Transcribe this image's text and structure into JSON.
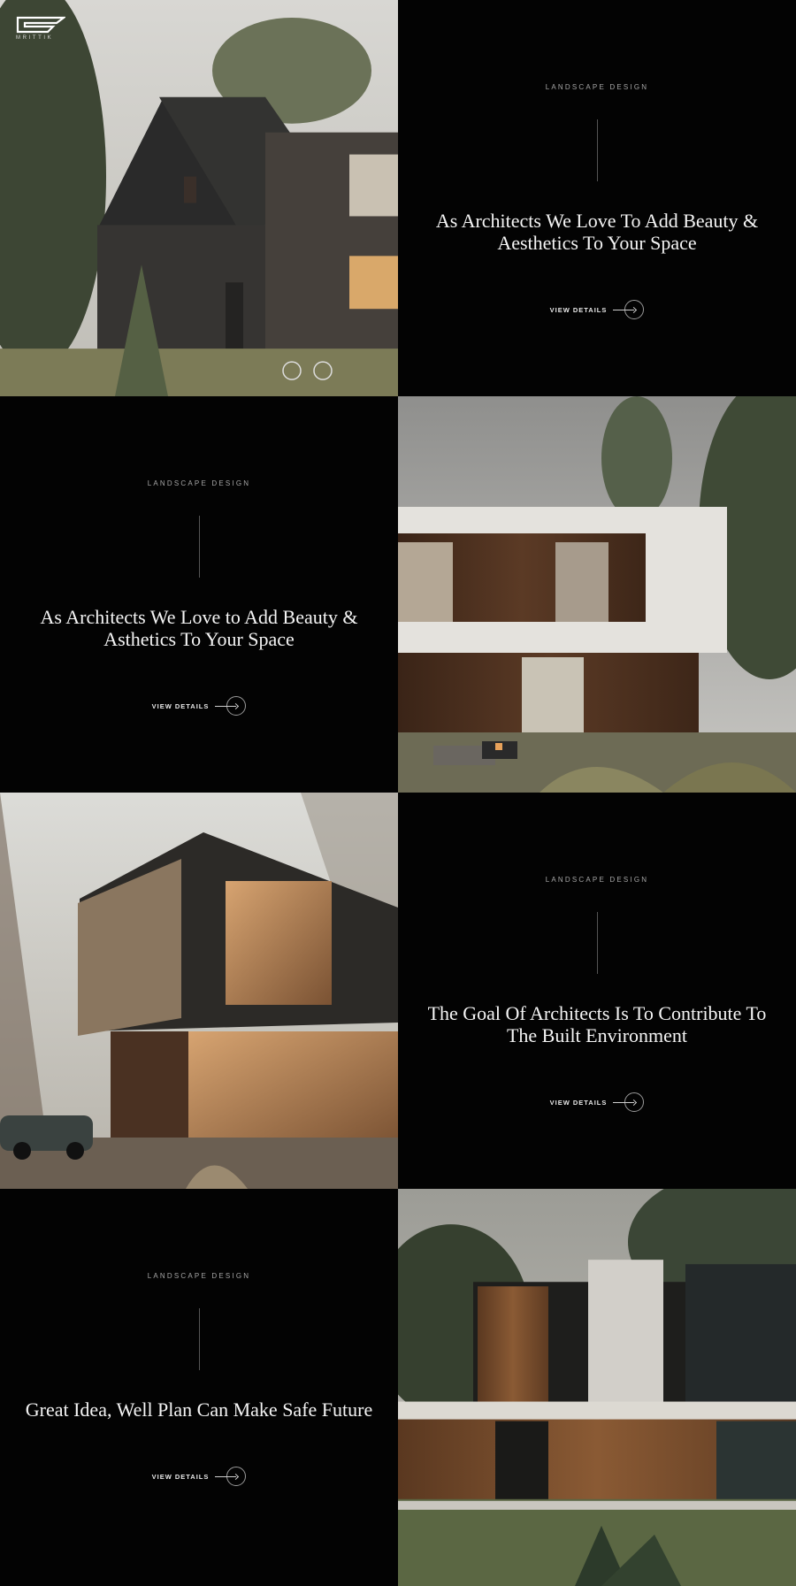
{
  "brand": {
    "logo_text": "MRITTIK",
    "logo_icon": "mrittik-logo-icon"
  },
  "sections": [
    {
      "eyebrow": "LANDSCAPE DESIGN",
      "heading": "As Architects We Love to Add Beauty & Asthetics To Your Space",
      "cta": "VIEW DETAILS",
      "image": "modern-house-white-box-wood-cladding"
    },
    {
      "eyebrow": "LANDSCAPE DESIGN",
      "heading": "The Goal Of Architects Is To Contribute To The Built Environment",
      "cta": "VIEW DETAILS",
      "image": "cantilevered-glass-house-forest-vintage-car"
    },
    {
      "eyebrow": "LANDSCAPE DESIGN",
      "heading": "Great Idea, Well Plan Can Make Safe Future",
      "cta": "VIEW DETAILS",
      "image": "two-storey-house-wood-slats-lawn"
    },
    {
      "eyebrow": "LANDSCAPE DESIGN",
      "heading": "As Architects We Love To Add Beauty & Aesthetics To Your Space",
      "cta": "VIEW DETAILS",
      "image": "dark-gable-house-pine-trees-bicycle"
    }
  ],
  "colors": {
    "background": "#030303",
    "text": "#f5f5f5",
    "muted": "#a6a6a6"
  }
}
